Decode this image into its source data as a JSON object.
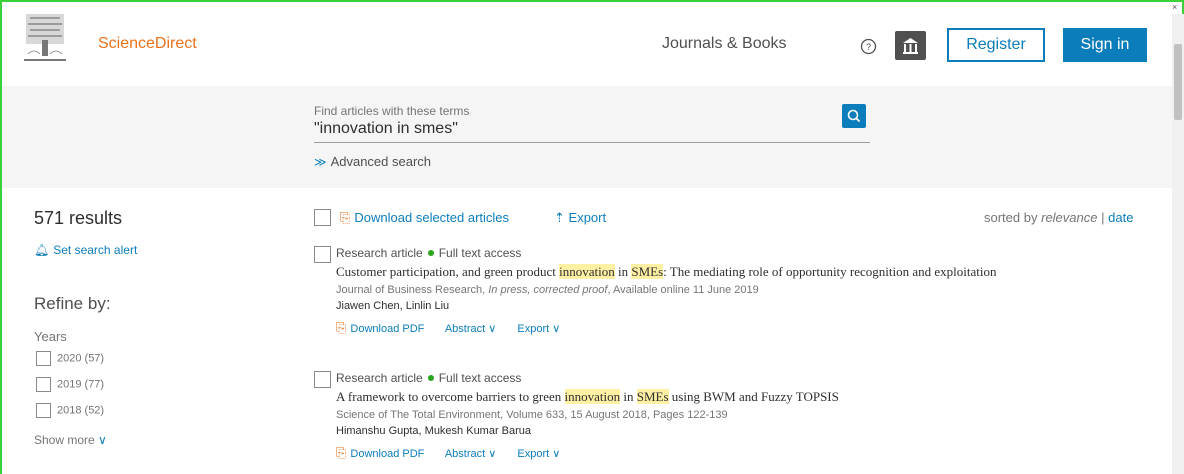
{
  "header": {
    "brand": "ScienceDirect",
    "nav_journals": "Journals & Books",
    "register_label": "Register",
    "signin_label": "Sign in",
    "close_glyph": "×"
  },
  "search": {
    "label": "Find articles with these terms",
    "value": "\"innovation in smes\"",
    "advanced_label": "Advanced search"
  },
  "sidebar": {
    "results_count": "571 results",
    "alert_label": "Set search alert",
    "refine_label": "Refine by:",
    "years_label": "Years",
    "years": [
      {
        "label": "2020 (57)"
      },
      {
        "label": "2019 (77)"
      },
      {
        "label": "2018 (52)"
      }
    ],
    "show_more": "Show more"
  },
  "toolbar": {
    "download_label": "Download selected articles",
    "export_label": "Export",
    "sorted_prefix": "sorted by",
    "sort_relevance": "relevance",
    "sort_separator": "|",
    "sort_date": "date"
  },
  "results": [
    {
      "type": "Research article",
      "access": "Full text access",
      "title_parts": [
        "Customer participation, and green product ",
        "innovation",
        " in ",
        "SMEs",
        ": The mediating role of opportunity recognition and exploitation"
      ],
      "source_journal": "Journal of Business Research,",
      "source_status": "In press, corrected proof",
      "source_rest": ", Available online 11 June 2019",
      "authors": "Jiawen Chen, Linlin Liu",
      "links": {
        "pdf": "Download PDF",
        "abstract": "Abstract",
        "export": "Export"
      }
    },
    {
      "type": "Research article",
      "access": "Full text access",
      "title_parts": [
        "A framework to overcome barriers to green ",
        "innovation",
        " in ",
        "SMEs",
        " using BWM and Fuzzy TOPSIS"
      ],
      "source_journal": "Science of The Total Environment, Volume 633, 15 August 2018, Pages 122-139",
      "source_status": "",
      "source_rest": "",
      "authors": "Himanshu Gupta, Mukesh Kumar Barua",
      "links": {
        "pdf": "Download PDF",
        "abstract": "Abstract",
        "export": "Export"
      }
    }
  ],
  "colors": {
    "accent": "#0c7dbb",
    "brand": "#e9711c",
    "open_access": "#29a61b",
    "highlight": "#fff0a3"
  }
}
